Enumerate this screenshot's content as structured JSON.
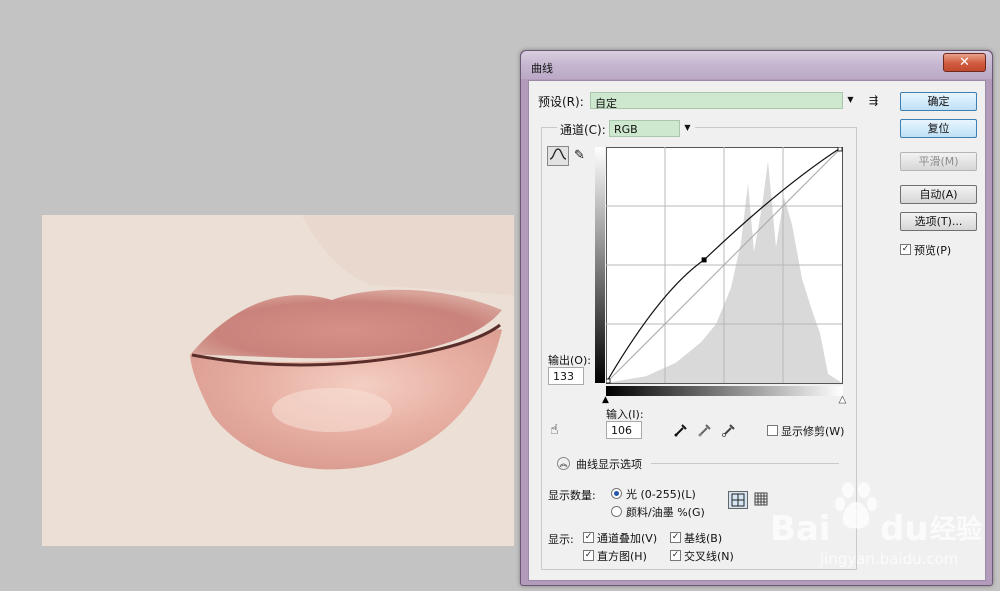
{
  "dialog": {
    "title": "曲线",
    "close_glyph": "✕",
    "preset_label": "预设(R):",
    "preset_value": "自定",
    "channel_label": "通道(C):",
    "channel_value": "RGB",
    "output_label": "输出(O):",
    "output_value": "133",
    "input_label": "输入(I):",
    "input_value": "106",
    "show_clipping_label": "显示修剪(W)",
    "curve_display_options_label": "曲线显示选项",
    "show_amount_label": "显示数量:",
    "light_option": "光 (0-255)(L)",
    "pigment_option": "颜料/油墨 %(G)",
    "show_label": "显示:",
    "channel_overlays_label": "通道叠加(V)",
    "baseline_label": "基线(B)",
    "histogram_label": "直方图(H)",
    "intersection_label": "交叉线(N)",
    "preview_label": "预览(P)"
  },
  "buttons": {
    "ok": "确定",
    "reset": "复位",
    "smooth": "平滑(M)",
    "auto": "自动(A)",
    "options": "选项(T)..."
  },
  "states": {
    "preview": true,
    "show_clipping": false,
    "channel_overlays": true,
    "baseline": true,
    "histogram": true,
    "intersection": true,
    "light_selected": true
  },
  "icons": {
    "curve_tool": "curve-tool-icon",
    "pencil_tool": "pencil-icon",
    "targeted_adjust": "hand-adjust-icon",
    "black_eyedropper": "eyedropper-black-icon",
    "gray_eyedropper": "eyedropper-gray-icon",
    "white_eyedropper": "eyedropper-white-icon",
    "preset_menu": "preset-options-icon",
    "expand": "chevron-up-icon",
    "grid_4": "grid-4-icon",
    "grid_10": "grid-10-icon"
  },
  "curve": {
    "point": [
      106,
      133
    ]
  },
  "watermark": {
    "brand": "Baidu经验",
    "url": "jingyan.baidu.com"
  }
}
